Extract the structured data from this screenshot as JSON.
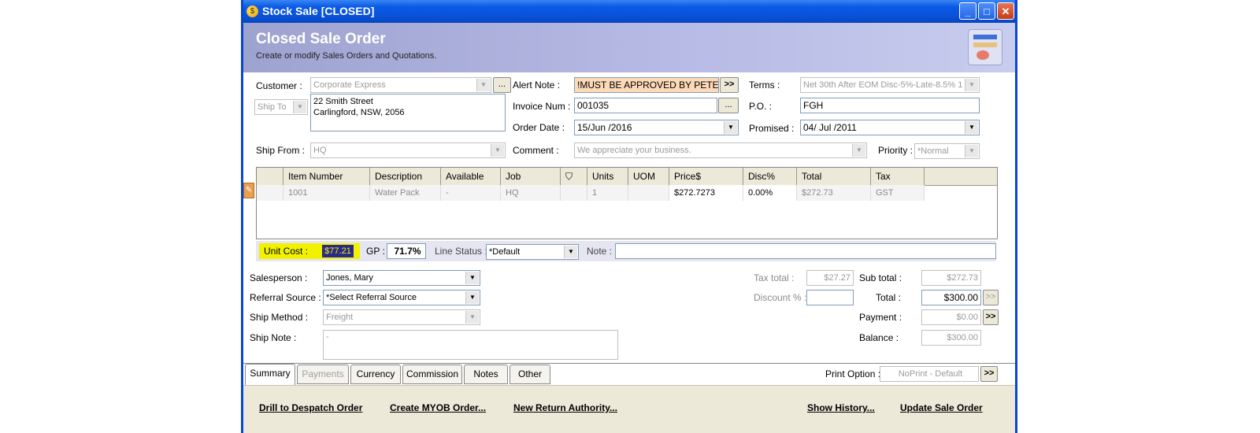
{
  "window": {
    "title": "Stock Sale [CLOSED]",
    "minimize": "_",
    "maximize": "□",
    "close": "✕"
  },
  "header": {
    "title": "Closed Sale Order",
    "subtitle": "Create or modify Sales Orders and Quotations."
  },
  "customer": {
    "label": "Customer :",
    "value": "Corporate Express",
    "browse": "...",
    "ship_to_label": "Ship To",
    "address_line1": "22 Smith Street",
    "address_line2": "Carlingford, NSW, 2056"
  },
  "ship_from": {
    "label": "Ship From :",
    "value": "HQ"
  },
  "alert_note": {
    "label": "Alert Note :",
    "value": "!MUST BE APPROVED BY PETER",
    "button": ">>"
  },
  "invoice": {
    "label": "Invoice Num :",
    "value": "001035",
    "browse": "..."
  },
  "order_date": {
    "label": "Order Date :",
    "value": "15/Jun /2016"
  },
  "comment": {
    "label": "Comment :",
    "value": "We appreciate your business."
  },
  "terms": {
    "label": "Terms :",
    "value": "Net 30th After EOM Disc-5%-Late-8.5% 1"
  },
  "po": {
    "label": "P.O. :",
    "value": "FGH"
  },
  "promised": {
    "label": "Promised :",
    "value": "04/ Jul /2011"
  },
  "priority": {
    "label": "Priority :",
    "value": "*Normal"
  },
  "grid": {
    "columns": [
      "Item Number",
      "Description",
      "Available",
      "Job",
      "⛉",
      "Units",
      "UOM",
      "Price$",
      "Disc%",
      "Total",
      "Tax"
    ],
    "rows": [
      [
        "1001",
        "Water Pack",
        "-",
        "HQ",
        "",
        "1",
        "",
        "$272.7273",
        "0.00%",
        "$272.73",
        "GST"
      ]
    ]
  },
  "line": {
    "unit_cost_label": "Unit Cost :",
    "unit_cost_value": "$77.21",
    "gp_label": "GP :",
    "gp_value": "71.7%",
    "line_status_label": "Line Status :",
    "line_status_value": "*Default",
    "note_label": "Note :",
    "note_value": ""
  },
  "salesperson": {
    "label": "Salesperson :",
    "value": "Jones, Mary"
  },
  "referral": {
    "label": "Referral Source :",
    "value": "*Select Referral Source"
  },
  "ship_method": {
    "label": "Ship Method :",
    "value": "Freight"
  },
  "ship_note": {
    "label": "Ship Note :",
    "value": "-"
  },
  "totals": {
    "tax_total_label": "Tax total :",
    "tax_total_value": "$27.27",
    "discount_label": "Discount % :",
    "discount_value": "",
    "sub_total_label": "Sub total :",
    "sub_total_value": "$272.73",
    "total_label": "Total :",
    "total_value": "$300.00",
    "payment_label": "Payment :",
    "payment_value": "$0.00",
    "balance_label": "Balance :",
    "balance_value": "$300.00",
    "arrow": ">>"
  },
  "tabs": [
    "Summary",
    "Payments",
    "Currency",
    "Commission",
    "Notes",
    "Other"
  ],
  "print_option": {
    "label": "Print Option :",
    "value": "NoPrint - Default",
    "arrow": ">>"
  },
  "actions": {
    "drill": "Drill to Despatch Order",
    "create_myob": "Create MYOB Order...",
    "new_return": "New Return Authority...",
    "show_history": "Show History...",
    "update": "Update Sale Order"
  },
  "colors": {
    "alert_bg": "#fcd9b8",
    "highlight": "#f2f200",
    "header": "#b8bce6",
    "title_bar": "#0a5ae6"
  }
}
